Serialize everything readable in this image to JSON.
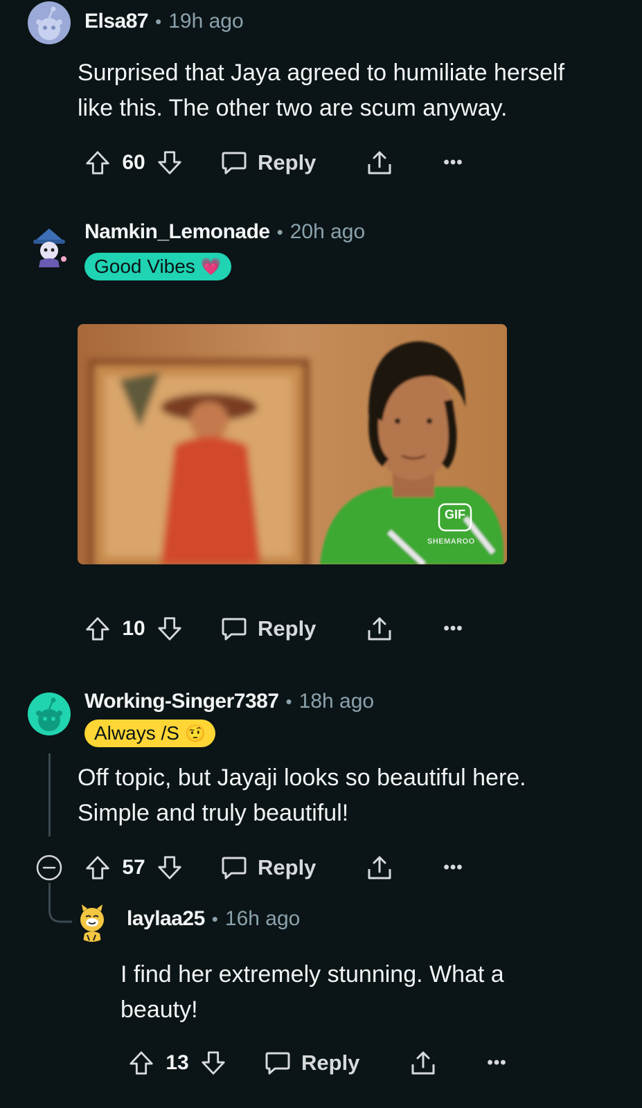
{
  "comments": [
    {
      "username": "Elsa87",
      "time": "19h ago",
      "text": "Surprised that Jaya agreed to humiliate herself like this. The other two are scum anyway.",
      "score": "60",
      "reply_label": "Reply",
      "more_label": "•••"
    },
    {
      "username": "Namkin_Lemonade",
      "time": "20h ago",
      "flair": "Good Vibes",
      "flair_emoji": "💗",
      "gif_badge": "GIF",
      "gif_watermark": "SHEMAROO",
      "score": "10",
      "reply_label": "Reply",
      "more_label": "•••"
    },
    {
      "username": "Working-Singer7387",
      "time": "18h ago",
      "flair": "Always /S",
      "flair_emoji": "🤨",
      "text": "Off topic, but Jayaji looks so beautiful here. Simple and truly beautiful!",
      "score": "57",
      "reply_label": "Reply",
      "more_label": "•••"
    },
    {
      "username": "laylaa25",
      "time": "16h ago",
      "text": "I find her extremely stunning. What a beauty!",
      "score": "13",
      "reply_label": "Reply",
      "more_label": "•••"
    }
  ],
  "colors": {
    "background": "#0b1416",
    "flair_good_vibes": "#1fd3b3",
    "flair_always_s": "#ffd635",
    "avatar_elsa": "#9aa9d8",
    "avatar_working": "#21d4b0",
    "muted": "#8ba2ad"
  },
  "icons": [
    "upvote-icon",
    "downvote-icon",
    "comment-icon",
    "share-icon",
    "more-icon",
    "collapse-icon"
  ]
}
